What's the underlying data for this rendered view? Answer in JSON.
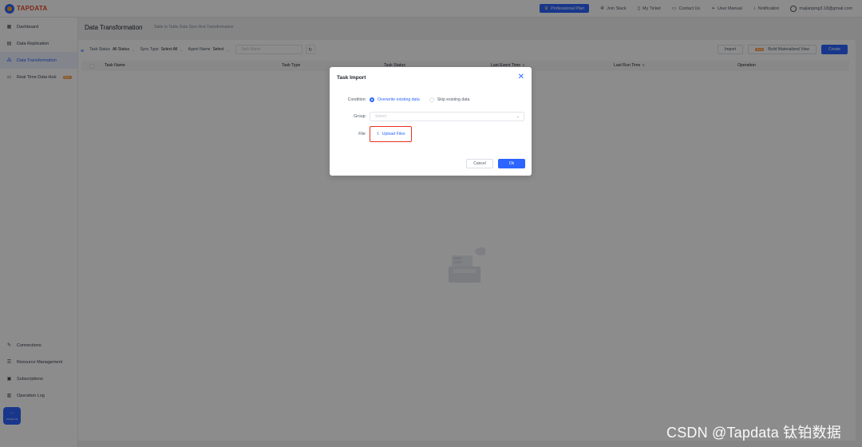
{
  "header": {
    "logo": "TAPDATA",
    "plan_label": "Professional Plan",
    "nav": {
      "join_slack": "Join Slack",
      "my_ticket": "My Ticket",
      "contact_us": "Contact Us",
      "user_manual": "User Manual",
      "notification": "Notification",
      "user_email": "majianping3.18@gmail.com"
    }
  },
  "sidebar": {
    "items": [
      {
        "label": "Dashboard",
        "icon": "dashboard-icon"
      },
      {
        "label": "Data Replication",
        "icon": "database-icon"
      },
      {
        "label": "Data Transformation",
        "icon": "transform-icon"
      },
      {
        "label": "Real Time Data Hub",
        "icon": "hub-icon",
        "badge": "Beta"
      }
    ],
    "bottom_items": [
      {
        "label": "Connections",
        "icon": "connection-icon"
      },
      {
        "label": "Resource Management",
        "icon": "resource-icon"
      },
      {
        "label": "Subscriptions",
        "icon": "subscription-icon"
      },
      {
        "label": "Operation Log",
        "icon": "log-icon"
      }
    ],
    "contact_chip": "Contact Us"
  },
  "page": {
    "title": "Data Transformation",
    "subtitle": "Table to Table Data Sync And Transformation"
  },
  "toolbar": {
    "task_status_label": "Task Status",
    "task_status_value": "All Status",
    "sync_type_label": "Sync Type",
    "sync_type_value": "Select All",
    "agent_name_label": "Agent Name",
    "agent_name_value": "Select",
    "search_placeholder": "Task Name",
    "import_label": "Import",
    "build_view_label": "Build Materialized View",
    "build_view_badge": "Beta",
    "create_label": "Create"
  },
  "table": {
    "columns": [
      "Task Name",
      "Task Type",
      "Task Status",
      "Last Event Time",
      "Last Run Time",
      "Operation"
    ]
  },
  "dialog": {
    "title": "Task Import",
    "condition_label": "Condition:",
    "option_overwrite": "Overwrite existing data",
    "option_skip": "Skip existing data",
    "selected_option": "overwrite",
    "group_label": "Group:",
    "group_placeholder": "Select",
    "file_label": "File:",
    "upload_label": "Upload Files",
    "cancel_label": "Cancel",
    "ok_label": "Ok"
  },
  "watermark": "CSDN @Tapdata 钛铂数据",
  "colors": {
    "accent": "#2c65ff",
    "highlight_border": "#e8321f",
    "overlay": "rgba(0,0,0,0.45)"
  }
}
